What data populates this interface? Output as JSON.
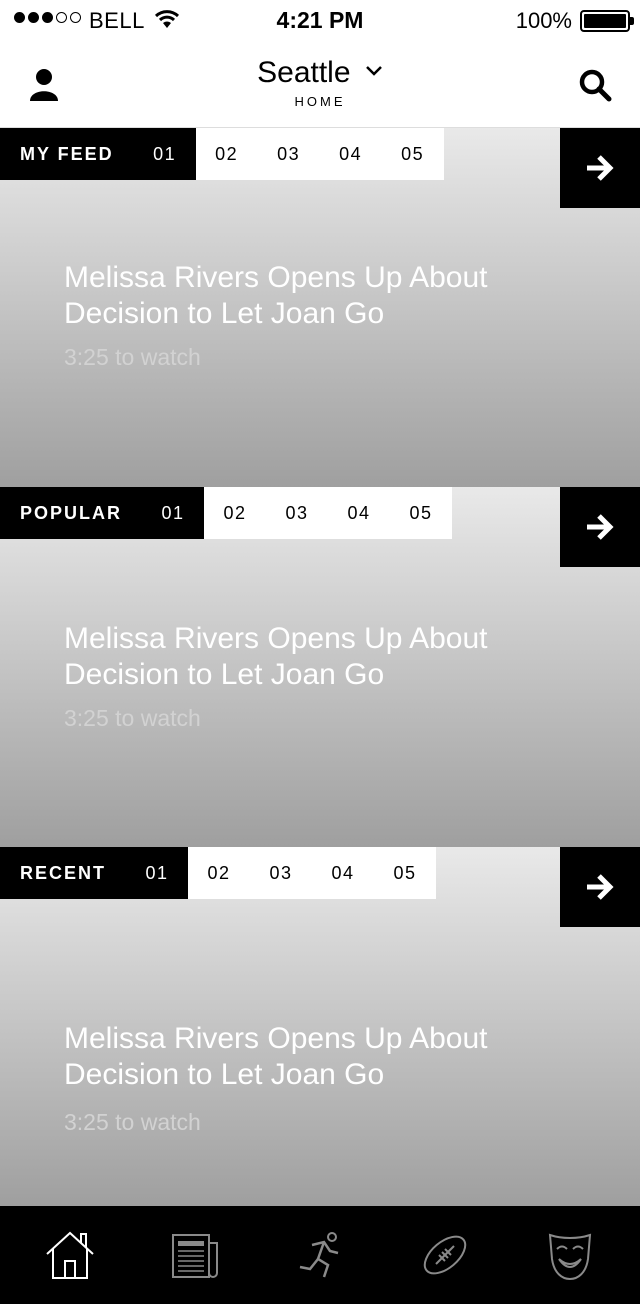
{
  "status": {
    "carrier": "BELL",
    "time": "4:21 PM",
    "battery": "100%",
    "signal_bars_filled": 3,
    "signal_bars_total": 5
  },
  "header": {
    "city": "Seattle",
    "subtitle": "HOME"
  },
  "sections": [
    {
      "label": "MY FEED",
      "tabs": [
        "01",
        "02",
        "03",
        "04",
        "05"
      ],
      "active_tab": "01",
      "headline": "Melissa Rivers Opens Up About Decision to Let Joan Go",
      "duration": "3:25 to watch"
    },
    {
      "label": "POPULAR",
      "tabs": [
        "01",
        "02",
        "03",
        "04",
        "05"
      ],
      "active_tab": "01",
      "headline": "Melissa Rivers Opens Up About Decision to Let Joan Go",
      "duration": "3:25 to watch"
    },
    {
      "label": "RECENT",
      "tabs": [
        "01",
        "02",
        "03",
        "04",
        "05"
      ],
      "active_tab": "01",
      "headline": "Melissa Rivers Opens Up About Decision to Let Joan Go",
      "duration": "3:25 to watch"
    }
  ],
  "bottom_nav": [
    {
      "icon": "home-icon",
      "active": true
    },
    {
      "icon": "newspaper-icon",
      "active": false
    },
    {
      "icon": "runner-icon",
      "active": false
    },
    {
      "icon": "football-icon",
      "active": false
    },
    {
      "icon": "theater-mask-icon",
      "active": false
    }
  ],
  "colors": {
    "bar": "#000000",
    "inactive_icon": "#8a8a8a",
    "active_icon": "#ffffff"
  }
}
